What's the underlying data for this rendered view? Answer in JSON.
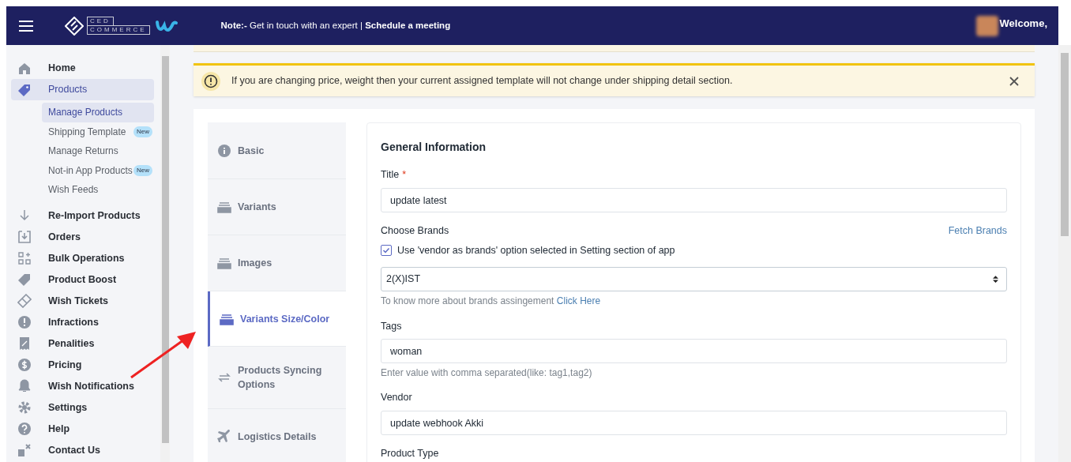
{
  "header": {
    "logo_top": "CED",
    "logo_bottom": "COMMERCE",
    "note_label": "Note:-",
    "note_text": "Get in touch with an expert |",
    "note_link": "Schedule a meeting",
    "welcome": "Welcome,"
  },
  "sidebar": {
    "items": [
      {
        "label": "Home",
        "selected": false
      },
      {
        "label": "Products",
        "selected": true,
        "expanded": true,
        "children": [
          {
            "label": "Manage Products",
            "selected": true
          },
          {
            "label": "Shipping Template",
            "selected": false,
            "badge": "New"
          },
          {
            "label": "Manage Returns",
            "selected": false
          },
          {
            "label": "Not-in App Products",
            "selected": false,
            "badge": "New"
          },
          {
            "label": "Wish Feeds",
            "selected": false
          }
        ]
      },
      {
        "label": "Re-Import Products",
        "selected": false
      },
      {
        "label": "Orders",
        "selected": false
      },
      {
        "label": "Bulk Operations",
        "selected": false
      },
      {
        "label": "Product Boost",
        "selected": false
      },
      {
        "label": "Wish Tickets",
        "selected": false
      },
      {
        "label": "Infractions",
        "selected": false
      },
      {
        "label": "Penalities",
        "selected": false
      },
      {
        "label": "Pricing",
        "selected": false
      },
      {
        "label": "Wish Notifications",
        "selected": false
      },
      {
        "label": "Settings",
        "selected": false
      },
      {
        "label": "Help",
        "selected": false
      },
      {
        "label": "Contact Us",
        "selected": false
      }
    ]
  },
  "alert": {
    "text": "If you are changing price, weight then your current assigned template will not change under shipping detail section."
  },
  "tabs": [
    {
      "label": "Basic",
      "selected": false
    },
    {
      "label": "Variants",
      "selected": false
    },
    {
      "label": "Images",
      "selected": false
    },
    {
      "label": "Variants Size/Color",
      "selected": true
    },
    {
      "label": "Products Syncing Options",
      "selected": false
    },
    {
      "label": "Logistics Details",
      "selected": false
    }
  ],
  "form": {
    "heading": "General Information",
    "title_label": "Title",
    "title_required_mark": "*",
    "title_value": "update latest",
    "brands_label": "Choose Brands",
    "fetch_link": "Fetch Brands",
    "vendor_checkbox": {
      "label": "Use 'vendor as brands' option selected in Setting section of app",
      "checked": true
    },
    "brand_value": "2(X)IST",
    "brand_help": "To know more about brands assingement",
    "brand_help_link": "Click Here",
    "tags_label": "Tags",
    "tags_value": "woman",
    "tags_help": "Enter value with comma separated(like: tag1,tag2)",
    "vendor_label": "Vendor",
    "vendor_value": "update webhook Akki",
    "type_label": "Product Type"
  }
}
